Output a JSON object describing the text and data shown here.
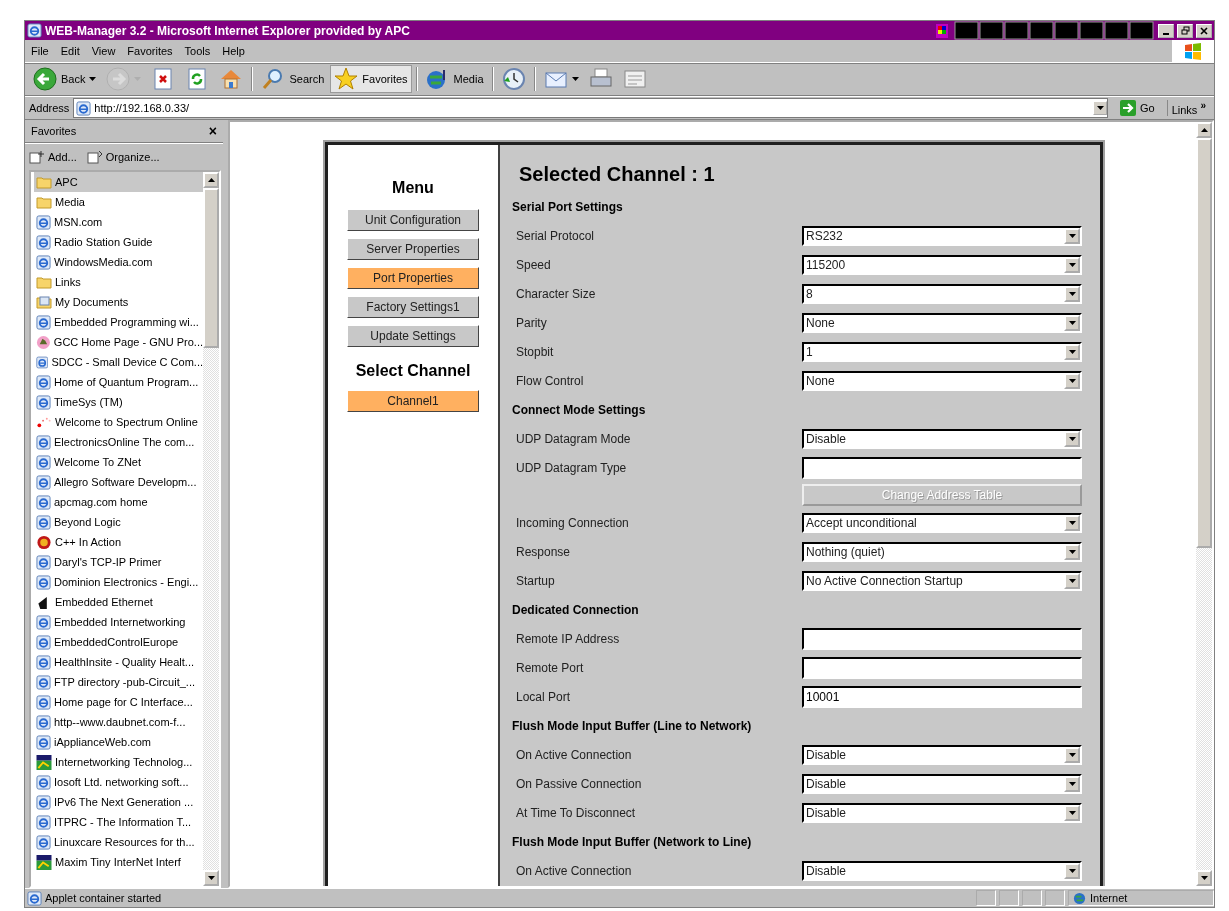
{
  "window": {
    "title": "WEB-Manager 3.2 - Microsoft Internet Explorer provided by APC"
  },
  "menu_bar": [
    "File",
    "Edit",
    "View",
    "Favorites",
    "Tools",
    "Help"
  ],
  "toolbar": [
    {
      "kind": "back",
      "label": "Back",
      "disabled": false,
      "pressed": false
    },
    {
      "kind": "forward",
      "disabled": true,
      "pressed": false
    },
    {
      "kind": "stop",
      "disabled": false,
      "pressed": false
    },
    {
      "kind": "refresh",
      "disabled": false,
      "pressed": false
    },
    {
      "kind": "home",
      "disabled": false,
      "pressed": false
    },
    {
      "kind": "search",
      "label": "Search",
      "disabled": false,
      "pressed": false
    },
    {
      "kind": "favorites",
      "label": "Favorites",
      "disabled": false,
      "pressed": true
    },
    {
      "kind": "media",
      "label": "Media",
      "disabled": false,
      "pressed": false
    },
    {
      "kind": "history",
      "disabled": false,
      "pressed": false
    },
    {
      "kind": "mail",
      "disabled": false,
      "pressed": false
    },
    {
      "kind": "print",
      "disabled": false,
      "pressed": false
    },
    {
      "kind": "edit",
      "disabled": false,
      "pressed": false
    }
  ],
  "address_bar": {
    "label": "Address",
    "url": "http://192.168.0.33/",
    "go": "Go",
    "links": "Links",
    "more": "»"
  },
  "favorites": {
    "title": "Favorites",
    "close": "×",
    "add": "Add...",
    "organize": "Organize...",
    "items": [
      {
        "label": "APC",
        "kind": "folder",
        "selected": true
      },
      {
        "label": "Media",
        "kind": "folder",
        "selected": false
      },
      {
        "label": "MSN.com",
        "kind": "web",
        "selected": false
      },
      {
        "label": "Radio Station Guide",
        "kind": "web",
        "selected": false
      },
      {
        "label": "WindowsMedia.com",
        "kind": "web",
        "selected": false
      },
      {
        "label": "Links",
        "kind": "folder",
        "selected": false
      },
      {
        "label": "My Documents",
        "kind": "documents",
        "selected": false
      },
      {
        "label": "Embedded Programming wi...",
        "kind": "web",
        "selected": false
      },
      {
        "label": "GCC Home Page - GNU Pro...",
        "kind": "gnu",
        "selected": false
      },
      {
        "label": "SDCC - Small Device C Com...",
        "kind": "web",
        "selected": false
      },
      {
        "label": "Home of Quantum Program...",
        "kind": "web",
        "selected": false
      },
      {
        "label": "TimeSys (TM)",
        "kind": "web",
        "selected": false
      },
      {
        "label": "Welcome to Spectrum Online",
        "kind": "dots",
        "selected": false
      },
      {
        "label": "ElectronicsOnline  The com...",
        "kind": "web",
        "selected": false
      },
      {
        "label": "Welcome To ZNet",
        "kind": "web",
        "selected": false
      },
      {
        "label": "Allegro Software Developm...",
        "kind": "web",
        "selected": false
      },
      {
        "label": "apcmag.com  home",
        "kind": "web",
        "selected": false
      },
      {
        "label": "Beyond Logic",
        "kind": "web",
        "selected": false
      },
      {
        "label": "C++ In Action",
        "kind": "badge",
        "selected": false
      },
      {
        "label": "Daryl's TCP-IP Primer",
        "kind": "web",
        "selected": false
      },
      {
        "label": "Dominion Electronics - Engi...",
        "kind": "web",
        "selected": false
      },
      {
        "label": "Embedded Ethernet",
        "kind": "dark",
        "selected": false
      },
      {
        "label": "Embedded Internetworking",
        "kind": "web",
        "selected": false
      },
      {
        "label": "EmbeddedControlEurope",
        "kind": "web",
        "selected": false
      },
      {
        "label": "HealthInsite - Quality Healt...",
        "kind": "web",
        "selected": false
      },
      {
        "label": "FTP directory -pub-Circuit_...",
        "kind": "web",
        "selected": false
      },
      {
        "label": "Home page for C Interface...",
        "kind": "web",
        "selected": false
      },
      {
        "label": "http--www.daubnet.com-f...",
        "kind": "web",
        "selected": false
      },
      {
        "label": "iApplianceWeb.com",
        "kind": "web",
        "selected": false
      },
      {
        "label": "Internetworking Technolog...",
        "kind": "grid",
        "selected": false
      },
      {
        "label": "Iosoft Ltd. networking soft...",
        "kind": "web",
        "selected": false
      },
      {
        "label": "IPv6 The Next Generation ...",
        "kind": "web",
        "selected": false
      },
      {
        "label": "ITPRC - The Information T...",
        "kind": "web",
        "selected": false
      },
      {
        "label": "Linuxcare Resources for th...",
        "kind": "web",
        "selected": false
      },
      {
        "label": "Maxim Tiny InterNet Interf",
        "kind": "grid",
        "selected": false
      }
    ]
  },
  "page": {
    "menu": {
      "title": "Menu",
      "buttons": [
        {
          "label": "Unit Configuration",
          "selected": false
        },
        {
          "label": "Server Properties",
          "selected": false
        },
        {
          "label": "Port Properties",
          "selected": true
        },
        {
          "label": "Factory Settings1",
          "selected": false
        },
        {
          "label": "Update Settings",
          "selected": false
        }
      ]
    },
    "channels": {
      "title": "Select Channel",
      "buttons": [
        {
          "label": "Channel1",
          "selected": true
        }
      ]
    },
    "heading": "Selected Channel : 1",
    "sections": [
      {
        "title": "Serial Port Settings",
        "rows": [
          {
            "label": "Serial Protocol",
            "kind": "select",
            "value": "RS232"
          },
          {
            "label": "Speed",
            "kind": "select",
            "value": "115200"
          },
          {
            "label": "Character Size",
            "kind": "select",
            "value": "8"
          },
          {
            "label": "Parity",
            "kind": "select",
            "value": "None"
          },
          {
            "label": "Stopbit",
            "kind": "select",
            "value": "1"
          },
          {
            "label": "Flow Control",
            "kind": "select",
            "value": "None"
          }
        ]
      },
      {
        "title": "Connect Mode Settings",
        "rows": [
          {
            "label": "UDP Datagram Mode",
            "kind": "select",
            "value": "Disable"
          },
          {
            "label": "UDP Datagram Type",
            "kind": "text"
          },
          {
            "kind": "button",
            "value": "Change Address Table",
            "disabled": true
          },
          {
            "label": "Incoming Connection",
            "kind": "select",
            "value": "Accept unconditional"
          },
          {
            "label": "Response",
            "kind": "select",
            "value": "Nothing (quiet)"
          },
          {
            "label": "Startup",
            "kind": "select",
            "value": "No Active Connection Startup"
          }
        ]
      },
      {
        "title": "Dedicated Connection",
        "rows": [
          {
            "label": "Remote IP Address",
            "kind": "text"
          },
          {
            "label": "Remote Port",
            "kind": "text"
          },
          {
            "label": "Local Port",
            "kind": "text",
            "value": "10001"
          }
        ]
      },
      {
        "title": "Flush Mode Input Buffer (Line to Network)",
        "rows": [
          {
            "label": "On Active Connection",
            "kind": "select",
            "value": "Disable"
          },
          {
            "label": "On Passive Connection",
            "kind": "select",
            "value": "Disable"
          },
          {
            "label": "At Time To Disconnect",
            "kind": "select",
            "value": "Disable"
          }
        ]
      },
      {
        "title": "Flush Mode Input Buffer (Network to Line)",
        "rows": [
          {
            "label": "On Active Connection",
            "kind": "select",
            "value": "Disable"
          }
        ]
      }
    ]
  },
  "status_bar": {
    "text": "Applet container started",
    "zone": "Internet"
  }
}
